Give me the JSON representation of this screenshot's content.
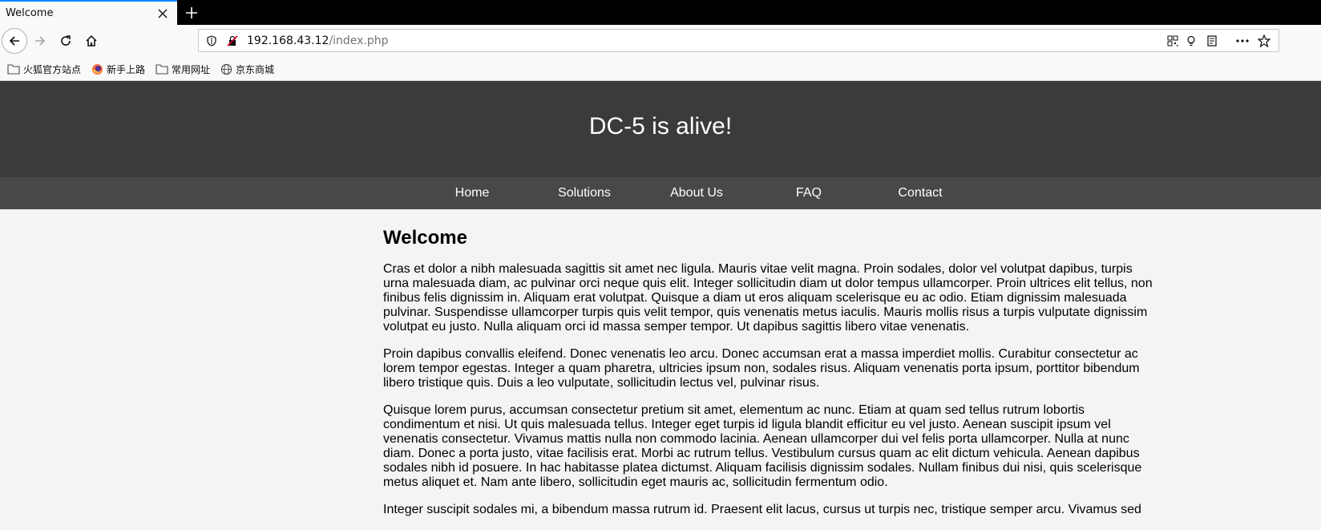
{
  "browser": {
    "tab_title": "Welcome",
    "url_host": "192.168.43.12",
    "url_path": "/index.php",
    "bookmarks": [
      {
        "label": "火狐官方站点",
        "icon": "folder-icon"
      },
      {
        "label": "新手上路",
        "icon": "firefox-icon"
      },
      {
        "label": "常用网址",
        "icon": "folder-icon"
      },
      {
        "label": "京东商城",
        "icon": "globe-icon"
      }
    ]
  },
  "page": {
    "site_title": "DC-5 is alive!",
    "menu": [
      "Home",
      "Solutions",
      "About Us",
      "FAQ",
      "Contact"
    ],
    "heading": "Welcome",
    "paragraphs": [
      "Cras et dolor a nibh malesuada sagittis sit amet nec ligula. Mauris vitae velit magna. Proin sodales, dolor vel volutpat dapibus, turpis urna malesuada diam, ac pulvinar orci neque quis elit. Integer sollicitudin diam ut dolor tempus ullamcorper. Proin ultrices elit tellus, non finibus felis dignissim in. Aliquam erat volutpat. Quisque a diam ut eros aliquam scelerisque eu ac odio. Etiam dignissim malesuada pulvinar. Suspendisse ullamcorper turpis quis velit tempor, quis venenatis metus iaculis. Mauris mollis risus a turpis vulputate dignissim volutpat eu justo. Nulla aliquam orci id massa semper tempor. Ut dapibus sagittis libero vitae venenatis.",
      "Proin dapibus convallis eleifend. Donec venenatis leo arcu. Donec accumsan erat a massa imperdiet mollis. Curabitur consectetur ac lorem tempor egestas. Integer a quam pharetra, ultricies ipsum non, sodales risus. Aliquam venenatis porta ipsum, porttitor bibendum libero tristique quis. Duis a leo vulputate, sollicitudin lectus vel, pulvinar risus.",
      "Quisque lorem purus, accumsan consectetur pretium sit amet, elementum ac nunc. Etiam at quam sed tellus rutrum lobortis condimentum et nisi. Ut quis malesuada tellus. Integer eget turpis id ligula blandit efficitur eu vel justo. Aenean suscipit ipsum vel venenatis consectetur. Vivamus mattis nulla non commodo lacinia. Aenean ullamcorper dui vel felis porta ullamcorper. Nulla at nunc diam. Donec a porta justo, vitae facilisis erat. Morbi ac rutrum tellus. Vestibulum cursus quam ac elit dictum vehicula. Aenean dapibus sodales nibh id posuere. In hac habitasse platea dictumst. Aliquam facilisis dignissim sodales. Nullam finibus dui nisi, quis scelerisque metus aliquet et. Nam ante libero, sollicitudin eget mauris ac, sollicitudin fermentum odio.",
      "Integer suscipit sodales mi, a bibendum massa rutrum id. Praesent elit lacus, cursus ut turpis nec, tristique semper arcu. Vivamus sed"
    ]
  }
}
